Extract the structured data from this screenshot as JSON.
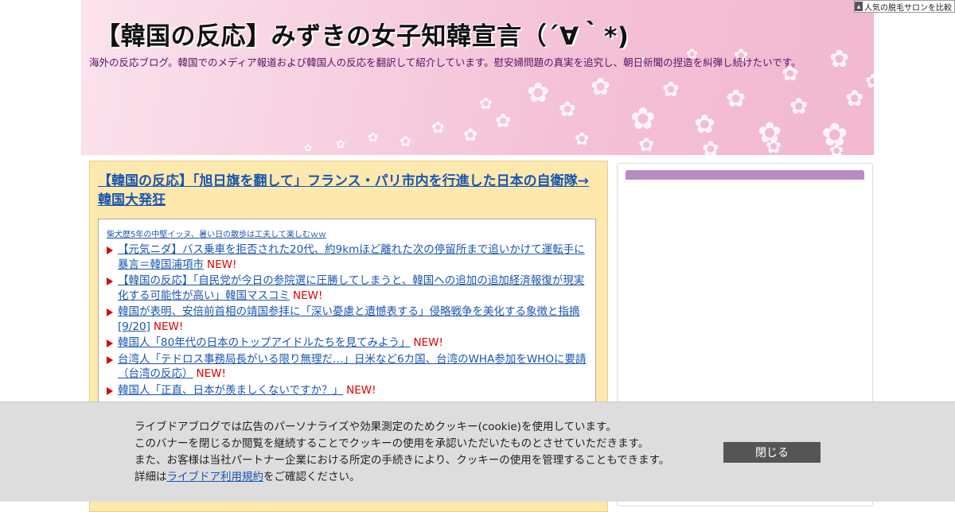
{
  "header": {
    "site_title": "【韓国の反応】みずきの女子知韓宣言（´∀｀*)",
    "site_description": "海外の反応ブログ。韓国でのメディア報道および韓国人の反応を翻訳して紹介しています。慰安婦問題の真実を追究し、朝日新聞の捏造を糾弾し続けたいです。"
  },
  "ad_badge": {
    "icon": "ad-info-icon",
    "label": "人気の脱毛サロンを比較"
  },
  "article": {
    "title": "【韓国の反応】「旭日旗を翻して」フランス・パリ市内を行進した日本の自衛隊→韓国大発狂"
  },
  "related": {
    "small_link": "柴犬歴5年の中堅イッヌ、暑い日の散歩は工夫して楽しむｗｗ",
    "new_label": "NEW!",
    "items": [
      {
        "text": "【元気ニダ】バス乗車を拒否された20代、約9kmほど離れた次の停留所まで追いかけて運転手に暴言＝韓国浦項市",
        "is_new": true
      },
      {
        "text": "【韓国の反応】「自民党が今日の参院選に圧勝してしまうと、韓国への追加の追加経済報復が現実化する可能性が高い」韓国マスコミ",
        "is_new": true
      },
      {
        "text": "韓国が表明、安倍前首相の靖国参拝に「深い憂慮と遺憾表する」侵略戦争を美化する象徴と指摘 [9/20]",
        "is_new": true
      },
      {
        "text": "韓国人「80年代の日本のトップアイドルたちを見てみよう」",
        "is_new": true
      },
      {
        "text": "台湾人「テドロス事務局長がいる限り無理だ…」日米など6カ国、台湾のWHA参加をWHOに要請（台湾の反応）",
        "is_new": true
      },
      {
        "text": "韓国人「正直、日本が羨ましくないですか？」",
        "is_new": true
      }
    ]
  },
  "cookie": {
    "line1": "ライブドアブログでは広告のパーソナライズや効果測定のためクッキー(cookie)を使用しています。",
    "line2": "このバナーを閉じるか閲覧を継続することでクッキーの使用を承認いただいたものとさせていただきます。",
    "line3": "また、お客様は当社パートナー企業における所定の手続きにより、クッキーの使用を管理することもできます。",
    "line4_prefix": "詳細は",
    "line4_link": "ライブドア利用規約",
    "line4_suffix": "をご確認ください。",
    "close_label": "閉じる"
  },
  "colors": {
    "link": "#1a56b0",
    "new": "#e00000",
    "article_bg": "#fde8ad",
    "sidebar_accent": "#b98bc4",
    "cookie_bg": "#dddddd",
    "close_button": "#555555",
    "description": "#5a0f63"
  }
}
